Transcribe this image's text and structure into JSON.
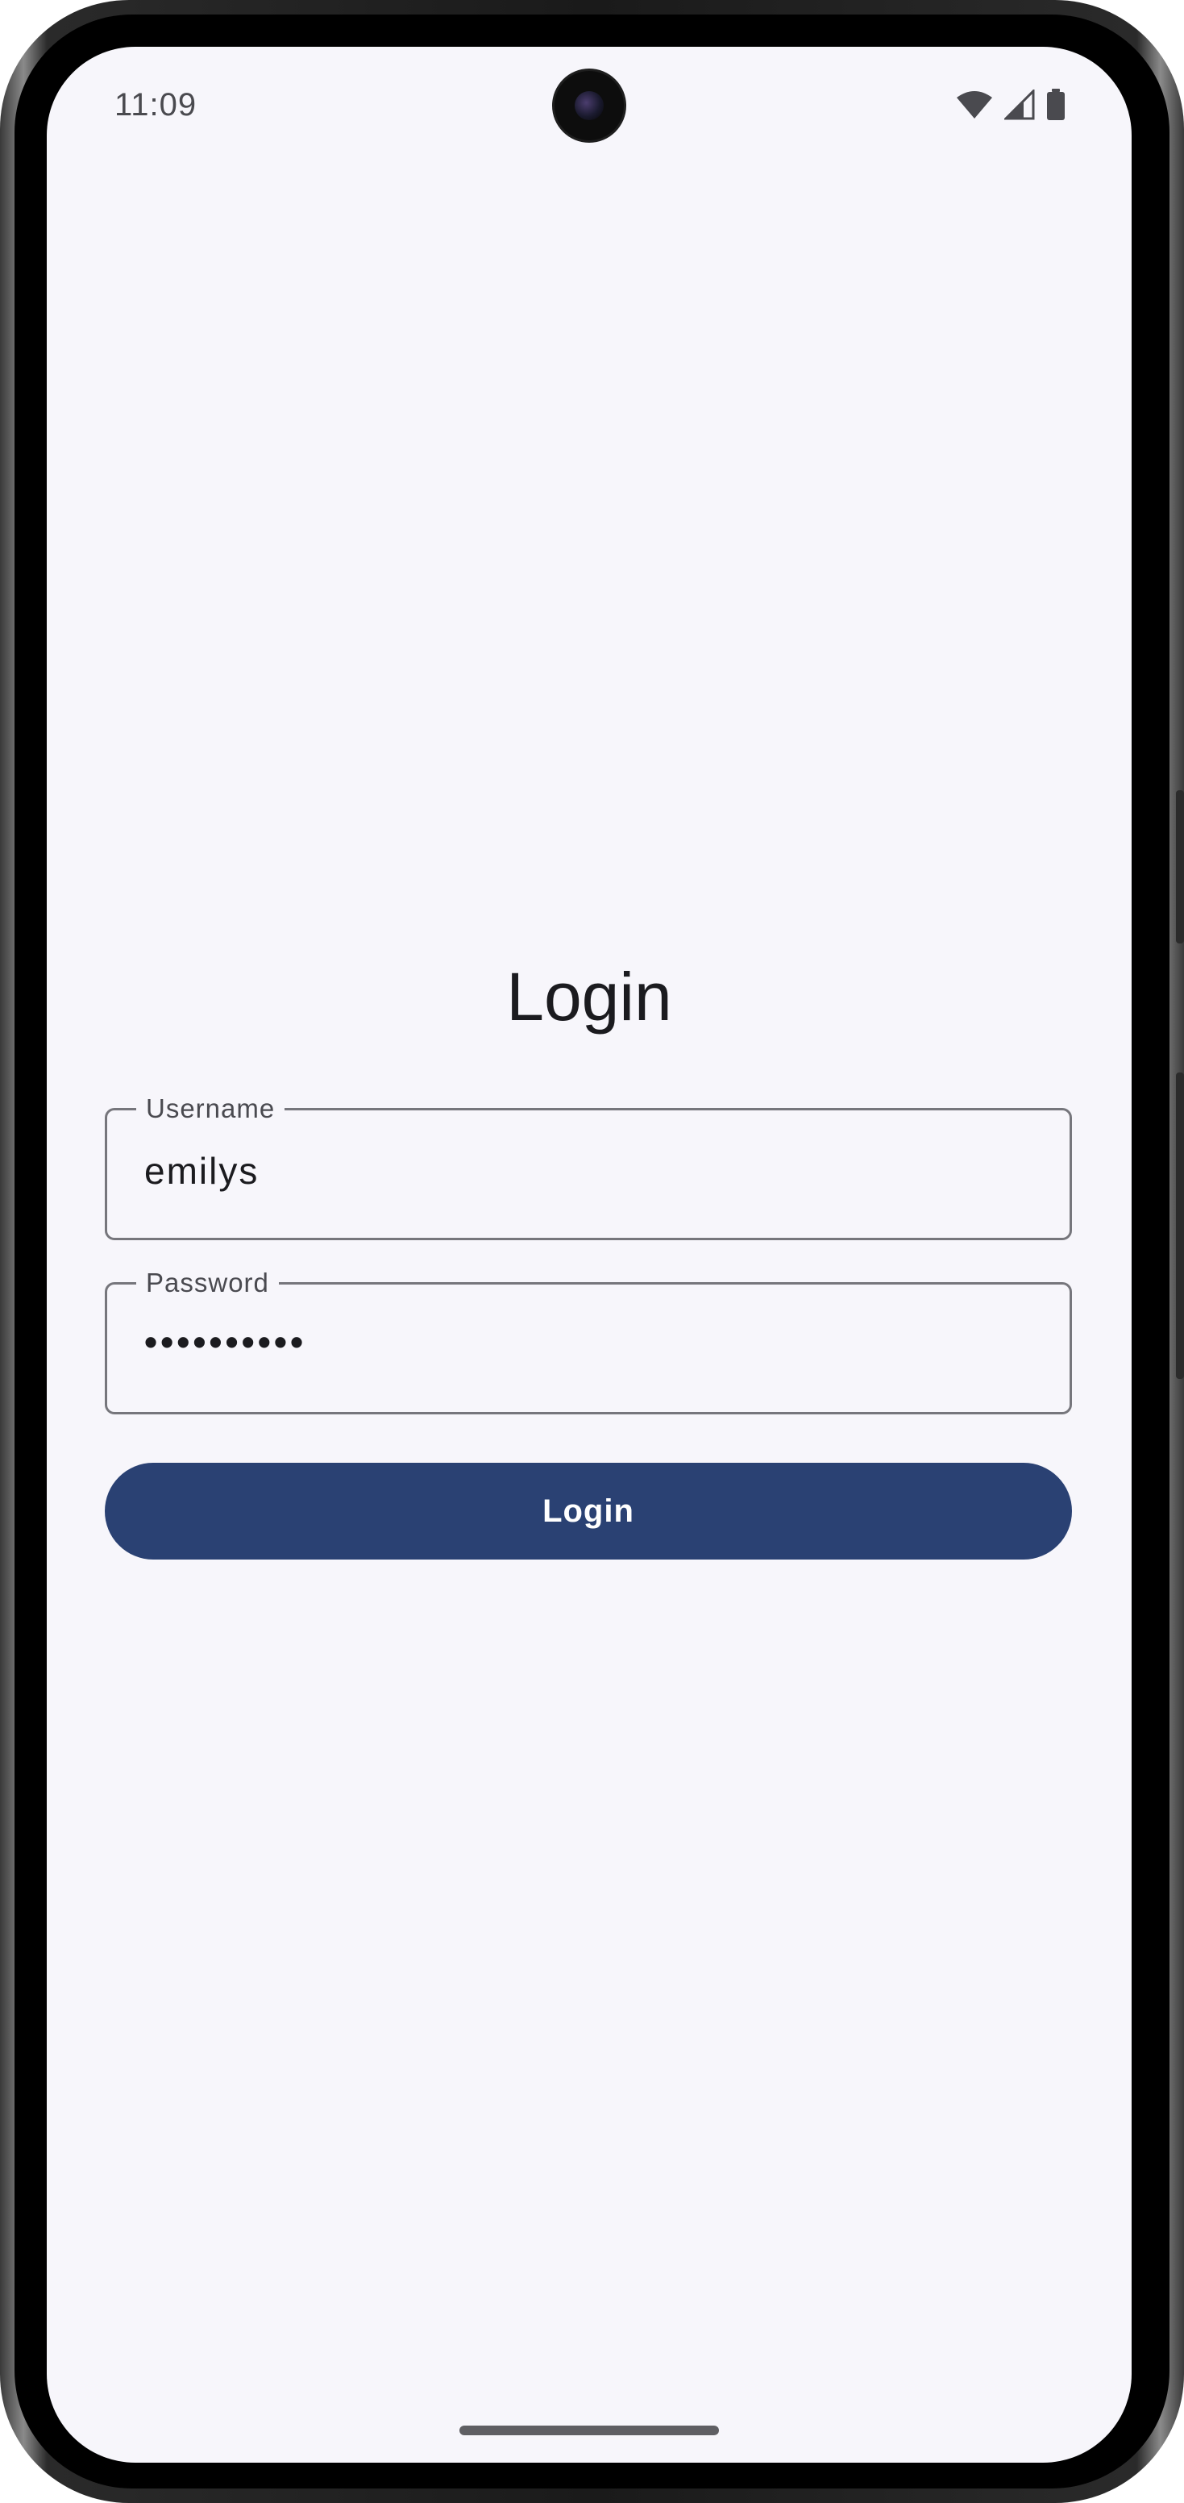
{
  "status_bar": {
    "time": "11:09",
    "icons": [
      "wifi-icon",
      "cellular-signal-icon",
      "battery-icon"
    ]
  },
  "login": {
    "title": "Login",
    "username": {
      "label": "Username",
      "value": "emilys"
    },
    "password": {
      "label": "Password",
      "value": "••••••••••"
    },
    "submit_label": "Login"
  },
  "colors": {
    "background": "#f7f6fb",
    "primary": "#2a4173",
    "outline": "#76767c",
    "text": "#1b1b1f"
  }
}
